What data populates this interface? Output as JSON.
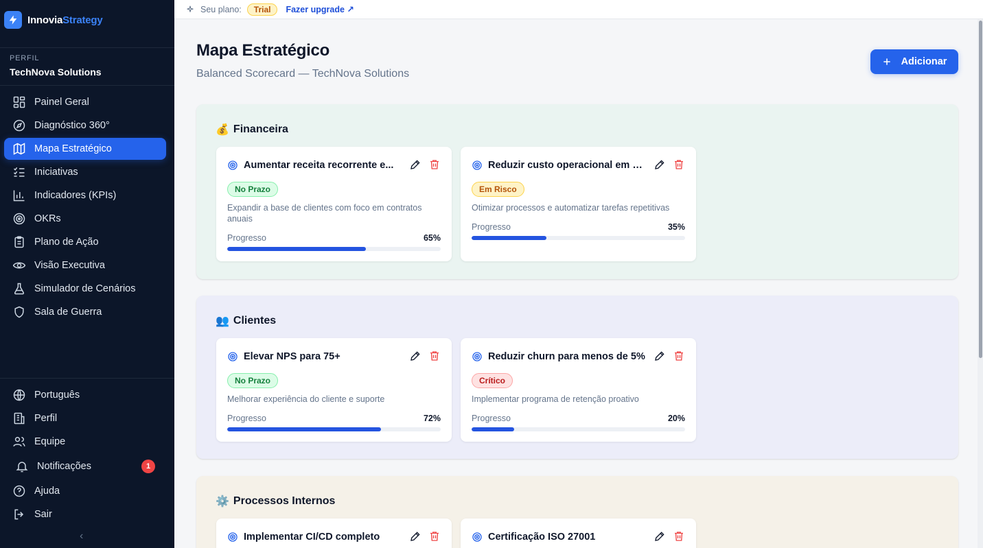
{
  "brand": {
    "name_a": "Innovia",
    "name_b": "Strategy"
  },
  "sidebar": {
    "perfil_label": "PERFIL",
    "perfil_name": "TechNova Solutions",
    "items": [
      {
        "label": "Painel Geral",
        "icon": "grid-icon"
      },
      {
        "label": "Diagnóstico 360°",
        "icon": "compass-icon"
      },
      {
        "label": "Mapa Estratégico",
        "icon": "map-icon",
        "active": true
      },
      {
        "label": "Iniciativas",
        "icon": "checklist-icon"
      },
      {
        "label": "Indicadores (KPIs)",
        "icon": "bar-chart-icon"
      },
      {
        "label": "OKRs",
        "icon": "target-icon"
      },
      {
        "label": "Plano de Ação",
        "icon": "clipboard-icon"
      },
      {
        "label": "Visão Executiva",
        "icon": "eye-icon"
      },
      {
        "label": "Simulador de Cenários",
        "icon": "flask-icon"
      },
      {
        "label": "Sala de Guerra",
        "icon": "shield-icon"
      }
    ],
    "bottom": [
      {
        "label": "Português",
        "icon": "globe-icon"
      },
      {
        "label": "Perfil",
        "icon": "building-icon"
      },
      {
        "label": "Equipe",
        "icon": "users-icon"
      },
      {
        "label": "Notificações",
        "icon": "bell-icon",
        "count": "1"
      },
      {
        "label": "Ajuda",
        "icon": "help-icon"
      },
      {
        "label": "Sair",
        "icon": "logout-icon"
      }
    ]
  },
  "topbar": {
    "plan_label": "Seu plano:",
    "plan": "Trial",
    "upgrade": "Fazer upgrade ↗"
  },
  "header": {
    "title": "Mapa Estratégico",
    "subtitle": "Balanced Scorecard — TechNova Solutions",
    "add_label": "Adicionar"
  },
  "perspectives": [
    {
      "emoji": "💰",
      "title": "Financeira",
      "objectives": [
        {
          "title": "Aumentar receita recorrente e...",
          "status": "No Prazo",
          "status_type": "ok",
          "desc": "Expandir a base de clientes com foco em contratos anuais",
          "progress_label": "Progresso",
          "progress": 65,
          "progress_text": "65%"
        },
        {
          "title": "Reduzir custo operacional em 1...",
          "status": "Em Risco",
          "status_type": "risk",
          "desc": "Otimizar processos e automatizar tarefas repetitivas",
          "progress_label": "Progresso",
          "progress": 35,
          "progress_text": "35%"
        }
      ]
    },
    {
      "emoji": "👥",
      "title": "Clientes",
      "objectives": [
        {
          "title": "Elevar NPS para 75+",
          "status": "No Prazo",
          "status_type": "ok",
          "desc": "Melhorar experiência do cliente e suporte",
          "progress_label": "Progresso",
          "progress": 72,
          "progress_text": "72%"
        },
        {
          "title": "Reduzir churn para menos de 5%",
          "status": "Crítico",
          "status_type": "crit",
          "desc": "Implementar programa de retenção proativo",
          "progress_label": "Progresso",
          "progress": 20,
          "progress_text": "20%"
        }
      ]
    },
    {
      "emoji": "⚙️",
      "title": "Processos Internos",
      "objectives": [
        {
          "title": "Implementar CI/CD completo"
        },
        {
          "title": "Certificação ISO 27001"
        }
      ]
    }
  ],
  "colors": {
    "accent": "#2563eb",
    "sidebar_bg": "#0c1629",
    "danger": "#ef4444"
  }
}
